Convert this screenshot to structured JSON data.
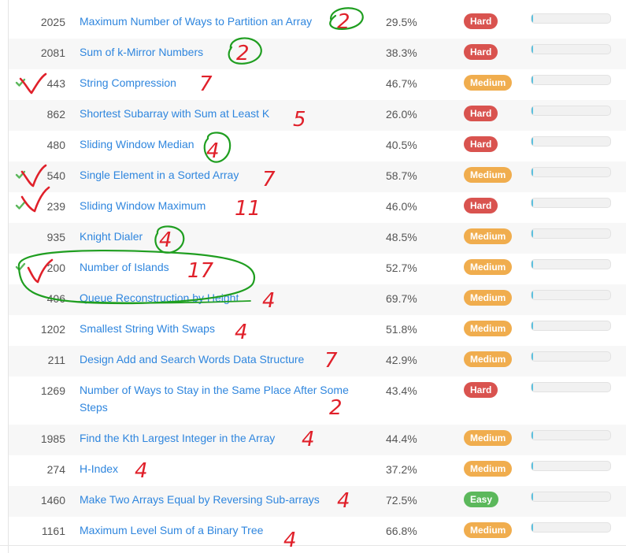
{
  "colors": {
    "hard": "#d9534f",
    "medium": "#f0ad4e",
    "easy": "#5cb85c",
    "link": "#2f86de",
    "check": "#5cb85c",
    "bar_fill": "#5bc0de",
    "annotation_red": "#e0202a",
    "annotation_green": "#1f9e20"
  },
  "problems": [
    {
      "id": "2025",
      "title": "Maximum Number of Ways to Partition an Array",
      "acceptance": "29.5%",
      "difficulty": "Hard",
      "solved": false,
      "frequency": 0.02,
      "note": "2"
    },
    {
      "id": "2081",
      "title": "Sum of k-Mirror Numbers",
      "acceptance": "38.3%",
      "difficulty": "Hard",
      "solved": false,
      "frequency": 0.02,
      "note": "2"
    },
    {
      "id": "443",
      "title": "String Compression",
      "acceptance": "46.7%",
      "difficulty": "Medium",
      "solved": true,
      "frequency": 0.02,
      "note": "7"
    },
    {
      "id": "862",
      "title": "Shortest Subarray with Sum at Least K",
      "acceptance": "26.0%",
      "difficulty": "Hard",
      "solved": false,
      "frequency": 0.02,
      "note": "5"
    },
    {
      "id": "480",
      "title": "Sliding Window Median",
      "acceptance": "40.5%",
      "difficulty": "Hard",
      "solved": false,
      "frequency": 0.02,
      "note": "4"
    },
    {
      "id": "540",
      "title": "Single Element in a Sorted Array",
      "acceptance": "58.7%",
      "difficulty": "Medium",
      "solved": true,
      "frequency": 0.02,
      "note": "7"
    },
    {
      "id": "239",
      "title": "Sliding Window Maximum",
      "acceptance": "46.0%",
      "difficulty": "Hard",
      "solved": true,
      "frequency": 0.02,
      "note": "11"
    },
    {
      "id": "935",
      "title": "Knight Dialer",
      "acceptance": "48.5%",
      "difficulty": "Medium",
      "solved": false,
      "frequency": 0.02,
      "note": "4"
    },
    {
      "id": "200",
      "title": "Number of Islands",
      "acceptance": "52.7%",
      "difficulty": "Medium",
      "solved": true,
      "frequency": 0.02,
      "note": "17"
    },
    {
      "id": "406",
      "title": "Queue Reconstruction by Height",
      "acceptance": "69.7%",
      "difficulty": "Medium",
      "solved": false,
      "frequency": 0.02,
      "note": "4"
    },
    {
      "id": "1202",
      "title": "Smallest String With Swaps",
      "acceptance": "51.8%",
      "difficulty": "Medium",
      "solved": false,
      "frequency": 0.02,
      "note": "4"
    },
    {
      "id": "211",
      "title": "Design Add and Search Words Data Structure",
      "acceptance": "42.9%",
      "difficulty": "Medium",
      "solved": false,
      "frequency": 0.02,
      "note": "7"
    },
    {
      "id": "1269",
      "title": "Number of Ways to Stay in the Same Place After Some Steps",
      "acceptance": "43.4%",
      "difficulty": "Hard",
      "solved": false,
      "frequency": 0.02,
      "note": "2"
    },
    {
      "id": "1985",
      "title": "Find the Kth Largest Integer in the Array",
      "acceptance": "44.4%",
      "difficulty": "Medium",
      "solved": false,
      "frequency": 0.02,
      "note": "4"
    },
    {
      "id": "274",
      "title": "H-Index",
      "acceptance": "37.2%",
      "difficulty": "Medium",
      "solved": false,
      "frequency": 0.02,
      "note": "4"
    },
    {
      "id": "1460",
      "title": "Make Two Arrays Equal by Reversing Sub-arrays",
      "acceptance": "72.5%",
      "difficulty": "Easy",
      "solved": false,
      "frequency": 0.02,
      "note": "4"
    },
    {
      "id": "1161",
      "title": "Maximum Level Sum of a Binary Tree",
      "acceptance": "66.8%",
      "difficulty": "Medium",
      "solved": false,
      "frequency": 0.02,
      "note": "4"
    }
  ]
}
